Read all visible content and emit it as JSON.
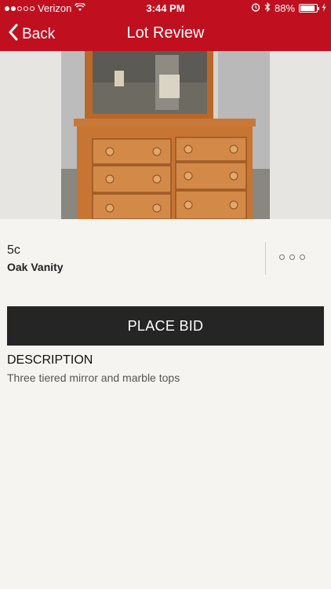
{
  "statusbar": {
    "carrier": "Verizon",
    "time": "3:44 PM",
    "battery_percent": "88%",
    "battery_level": 0.88,
    "signal_bars_filled": 2,
    "signal_bars_total": 5
  },
  "navbar": {
    "back_label": "Back",
    "title": "Lot Review"
  },
  "lot": {
    "number": "5c",
    "name": "Oak Vanity"
  },
  "actions": {
    "place_bid_label": "PLACE BID"
  },
  "description": {
    "heading": "DESCRIPTION",
    "text": "Three tiered mirror and marble tops"
  },
  "colors": {
    "brand_red": "#c0101f",
    "button_dark": "#252525",
    "background": "#f5f4f0"
  },
  "icons": [
    "chevron-left-icon",
    "wifi-icon",
    "alarm-icon",
    "bluetooth-icon",
    "battery-icon",
    "charging-icon",
    "more-icon"
  ]
}
